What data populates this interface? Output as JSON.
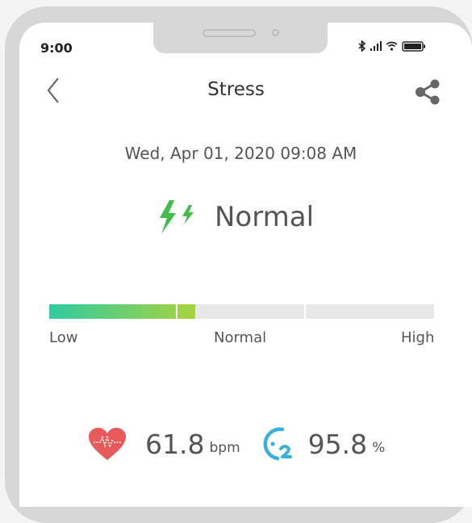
{
  "status_bar": {
    "time": "9:00"
  },
  "header": {
    "title": "Stress"
  },
  "measurement": {
    "timestamp": "Wed, Apr 01, 2020 09:08 AM",
    "level": "Normal",
    "level_fraction": 0.38
  },
  "scale": {
    "low": "Low",
    "normal": "Normal",
    "high": "High"
  },
  "heart_rate": {
    "value": "61.8",
    "unit": "bpm"
  },
  "oxygen": {
    "value": "95.8",
    "unit": "%"
  },
  "colors": {
    "accent_green": "#3fbf4a",
    "gradient_start": "#2fcba0",
    "gradient_end": "#a8d23e",
    "heart_red": "#e85a5a",
    "oxygen_teal": "#3bb0d8"
  },
  "icons": {
    "back": "chevron-left-icon",
    "share": "share-icon",
    "status": "bolt-icon",
    "heart": "heart-icon",
    "oxygen": "o2-icon"
  }
}
